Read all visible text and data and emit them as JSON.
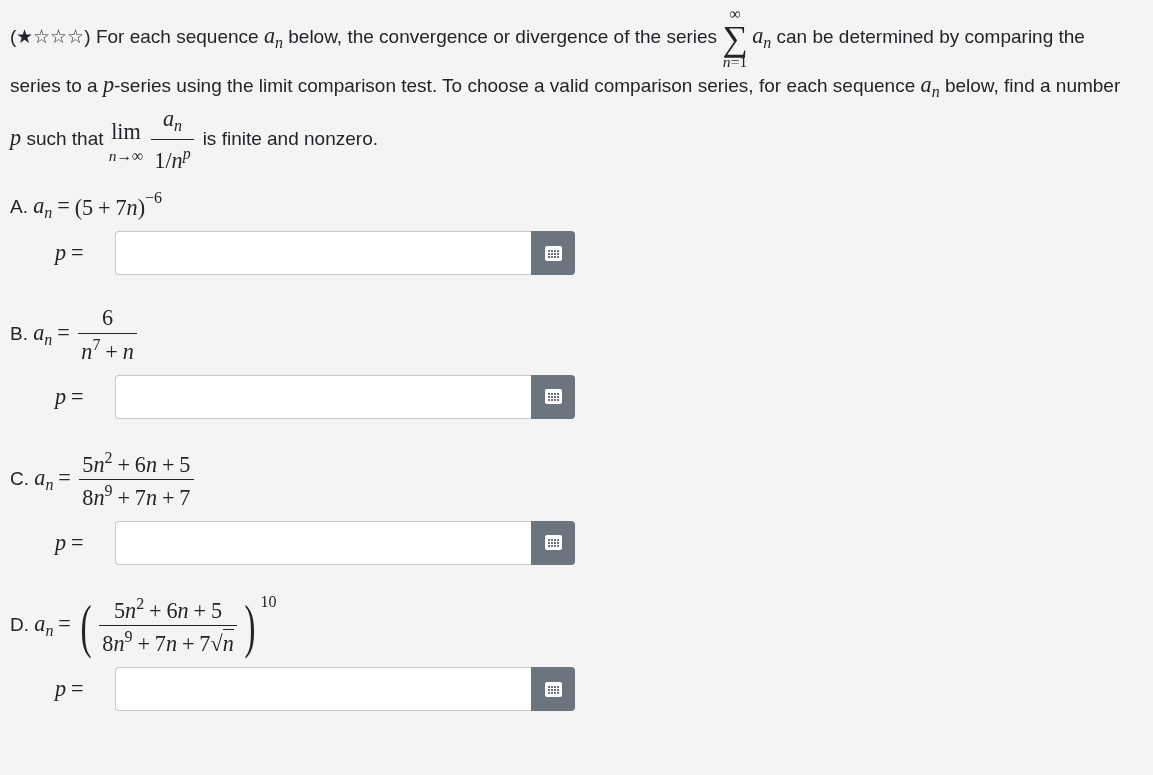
{
  "question": {
    "segments": [
      {
        "kind": "text",
        "text": "(★☆☆☆) For each sequence "
      },
      {
        "kind": "math",
        "nodes": [
          {
            "kind": "sub",
            "base": [
              {
                "kind": "mi",
                "text": "a"
              }
            ],
            "sub": [
              {
                "kind": "mi",
                "text": "n"
              }
            ]
          }
        ]
      },
      {
        "kind": "text",
        "text": " below, the convergence or divergence of the series "
      },
      {
        "kind": "math",
        "nodes": [
          {
            "kind": "sum",
            "symbol": "∑",
            "over": [
              {
                "kind": "mn",
                "text": "∞"
              }
            ],
            "under": [
              {
                "kind": "mi",
                "text": "n"
              },
              {
                "kind": "mn",
                "text": "="
              },
              {
                "kind": "mn",
                "text": "1"
              }
            ]
          },
          {
            "kind": "sub",
            "base": [
              {
                "kind": "mi",
                "text": "a"
              }
            ],
            "sub": [
              {
                "kind": "mi",
                "text": "n"
              }
            ]
          }
        ]
      },
      {
        "kind": "text",
        "text": " can be determined by comparing the series to a "
      },
      {
        "kind": "math",
        "nodes": [
          {
            "kind": "mi",
            "text": "p"
          }
        ]
      },
      {
        "kind": "text",
        "text": "-series using the limit comparison test. To choose a valid comparison series, for each sequence "
      },
      {
        "kind": "math",
        "nodes": [
          {
            "kind": "sub",
            "base": [
              {
                "kind": "mi",
                "text": "a"
              }
            ],
            "sub": [
              {
                "kind": "mi",
                "text": "n"
              }
            ]
          }
        ]
      },
      {
        "kind": "text",
        "text": " below, find a number "
      },
      {
        "kind": "math",
        "nodes": [
          {
            "kind": "mi",
            "text": "p"
          }
        ]
      },
      {
        "kind": "text",
        "text": " such that "
      },
      {
        "kind": "math",
        "nodes": [
          {
            "kind": "lim",
            "text": "lim",
            "under": [
              {
                "kind": "mi",
                "text": "n"
              },
              {
                "kind": "mn",
                "text": "→∞"
              }
            ]
          },
          {
            "kind": "frac",
            "num": [
              {
                "kind": "sub",
                "base": [
                  {
                    "kind": "mi",
                    "text": "a"
                  }
                ],
                "sub": [
                  {
                    "kind": "mi",
                    "text": "n"
                  }
                ]
              }
            ],
            "den": [
              {
                "kind": "mn",
                "text": "1/"
              },
              {
                "kind": "sup",
                "base": [
                  {
                    "kind": "mi",
                    "text": "n"
                  }
                ],
                "sup": [
                  {
                    "kind": "mi",
                    "text": "p"
                  }
                ]
              }
            ]
          }
        ]
      },
      {
        "kind": "text",
        "text": " is finite and nonzero."
      }
    ]
  },
  "parts": [
    {
      "label": "A.",
      "lhs": [
        {
          "kind": "sub",
          "base": [
            {
              "kind": "mi",
              "text": "a"
            }
          ],
          "sub": [
            {
              "kind": "mi",
              "text": "n"
            }
          ]
        },
        {
          "kind": "mo",
          "text": "="
        }
      ],
      "rhs": [
        {
          "kind": "paren",
          "big": false,
          "open": "(",
          "close": ")",
          "body": [
            {
              "kind": "mn",
              "text": "5"
            },
            {
              "kind": "mo",
              "text": "+"
            },
            {
              "kind": "mn",
              "text": "7"
            },
            {
              "kind": "mi",
              "text": "n"
            }
          ],
          "sup": [
            {
              "kind": "mn",
              "text": "−6"
            }
          ]
        }
      ],
      "answer_label": [
        {
          "kind": "mi",
          "text": "p"
        },
        {
          "kind": "mo",
          "text": "="
        }
      ]
    },
    {
      "label": "B.",
      "lhs": [
        {
          "kind": "sub",
          "base": [
            {
              "kind": "mi",
              "text": "a"
            }
          ],
          "sub": [
            {
              "kind": "mi",
              "text": "n"
            }
          ]
        },
        {
          "kind": "mo",
          "text": "="
        }
      ],
      "rhs": [
        {
          "kind": "frac",
          "num": [
            {
              "kind": "mn",
              "text": "6"
            }
          ],
          "den": [
            {
              "kind": "sup",
              "base": [
                {
                  "kind": "mi",
                  "text": "n"
                }
              ],
              "sup": [
                {
                  "kind": "mn",
                  "text": "7"
                }
              ]
            },
            {
              "kind": "mo",
              "text": "+"
            },
            {
              "kind": "mi",
              "text": "n"
            }
          ]
        }
      ],
      "answer_label": [
        {
          "kind": "mi",
          "text": "p"
        },
        {
          "kind": "mo",
          "text": "="
        }
      ]
    },
    {
      "label": "C.",
      "lhs": [
        {
          "kind": "sub",
          "base": [
            {
              "kind": "mi",
              "text": "a"
            }
          ],
          "sub": [
            {
              "kind": "mi",
              "text": "n"
            }
          ]
        },
        {
          "kind": "mo",
          "text": "="
        }
      ],
      "rhs": [
        {
          "kind": "frac",
          "num": [
            {
              "kind": "mn",
              "text": "5"
            },
            {
              "kind": "sup",
              "base": [
                {
                  "kind": "mi",
                  "text": "n"
                }
              ],
              "sup": [
                {
                  "kind": "mn",
                  "text": "2"
                }
              ]
            },
            {
              "kind": "mo",
              "text": "+"
            },
            {
              "kind": "mn",
              "text": "6"
            },
            {
              "kind": "mi",
              "text": "n"
            },
            {
              "kind": "mo",
              "text": "+"
            },
            {
              "kind": "mn",
              "text": "5"
            }
          ],
          "den": [
            {
              "kind": "mn",
              "text": "8"
            },
            {
              "kind": "sup",
              "base": [
                {
                  "kind": "mi",
                  "text": "n"
                }
              ],
              "sup": [
                {
                  "kind": "mn",
                  "text": "9"
                }
              ]
            },
            {
              "kind": "mo",
              "text": "+"
            },
            {
              "kind": "mn",
              "text": "7"
            },
            {
              "kind": "mi",
              "text": "n"
            },
            {
              "kind": "mo",
              "text": "+"
            },
            {
              "kind": "mn",
              "text": "7"
            }
          ]
        }
      ],
      "answer_label": [
        {
          "kind": "mi",
          "text": "p"
        },
        {
          "kind": "mo",
          "text": "="
        }
      ]
    },
    {
      "label": "D.",
      "lhs": [
        {
          "kind": "sub",
          "base": [
            {
              "kind": "mi",
              "text": "a"
            }
          ],
          "sub": [
            {
              "kind": "mi",
              "text": "n"
            }
          ]
        },
        {
          "kind": "mo",
          "text": "="
        }
      ],
      "rhs": [
        {
          "kind": "paren",
          "big": true,
          "open": "(",
          "close": ")",
          "body": [
            {
              "kind": "frac",
              "num": [
                {
                  "kind": "mn",
                  "text": "5"
                },
                {
                  "kind": "sup",
                  "base": [
                    {
                      "kind": "mi",
                      "text": "n"
                    }
                  ],
                  "sup": [
                    {
                      "kind": "mn",
                      "text": "2"
                    }
                  ]
                },
                {
                  "kind": "mo",
                  "text": "+"
                },
                {
                  "kind": "mn",
                  "text": "6"
                },
                {
                  "kind": "mi",
                  "text": "n"
                },
                {
                  "kind": "mo",
                  "text": "+"
                },
                {
                  "kind": "mn",
                  "text": "5"
                }
              ],
              "den": [
                {
                  "kind": "mn",
                  "text": "8"
                },
                {
                  "kind": "sup",
                  "base": [
                    {
                      "kind": "mi",
                      "text": "n"
                    }
                  ],
                  "sup": [
                    {
                      "kind": "mn",
                      "text": "9"
                    }
                  ]
                },
                {
                  "kind": "mo",
                  "text": "+"
                },
                {
                  "kind": "mn",
                  "text": "7"
                },
                {
                  "kind": "mi",
                  "text": "n"
                },
                {
                  "kind": "mo",
                  "text": "+"
                },
                {
                  "kind": "mn",
                  "text": "7"
                },
                {
                  "kind": "sqrt",
                  "symbol": "√",
                  "body": [
                    {
                      "kind": "mi",
                      "text": "n"
                    }
                  ]
                }
              ]
            }
          ],
          "sup": [
            {
              "kind": "mn",
              "text": "10"
            }
          ]
        }
      ],
      "answer_label": [
        {
          "kind": "mi",
          "text": "p"
        },
        {
          "kind": "mo",
          "text": "="
        }
      ]
    }
  ]
}
